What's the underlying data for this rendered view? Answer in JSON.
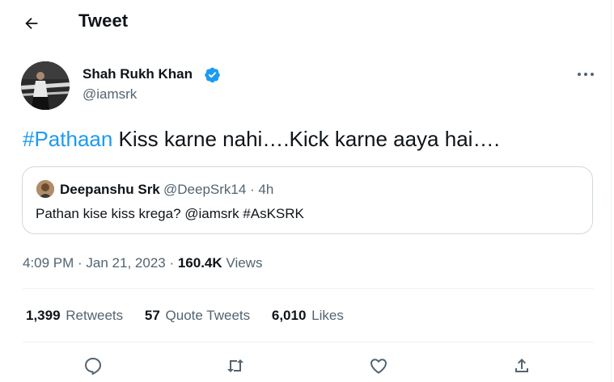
{
  "header": {
    "title": "Tweet",
    "back_icon": "back-arrow-icon"
  },
  "tweet": {
    "author_name": "Shah Rukh Khan",
    "author_handle": "@iamsrk",
    "verified_icon": "verified-badge-icon",
    "verified_color": "#1d9bf0",
    "hashtag": "#Pathaan",
    "text": " Kiss karne nahi….Kick karne aaya hai….",
    "quote": {
      "author_name": "Deepanshu Srk",
      "handle_time": "@DeepSrk14 · 4h",
      "text": "Pathan kise kiss krega? @iamsrk #AsKSRK"
    },
    "time": "4:09 PM · Jan 21, 2023 ·",
    "views_count": "160.4K",
    "views_label": "Views"
  },
  "stats": {
    "retweets_count": "1,399",
    "retweets_label": "Retweets",
    "quotes_count": "57",
    "quotes_label": "Quote Tweets",
    "likes_count": "6,010",
    "likes_label": "Likes"
  },
  "actions": [
    "reply-icon",
    "retweet-icon",
    "like-icon",
    "share-icon"
  ],
  "colors": {
    "accent": "#1d9bf0",
    "secondary_text": "#536471",
    "primary_text": "#0f1419"
  }
}
